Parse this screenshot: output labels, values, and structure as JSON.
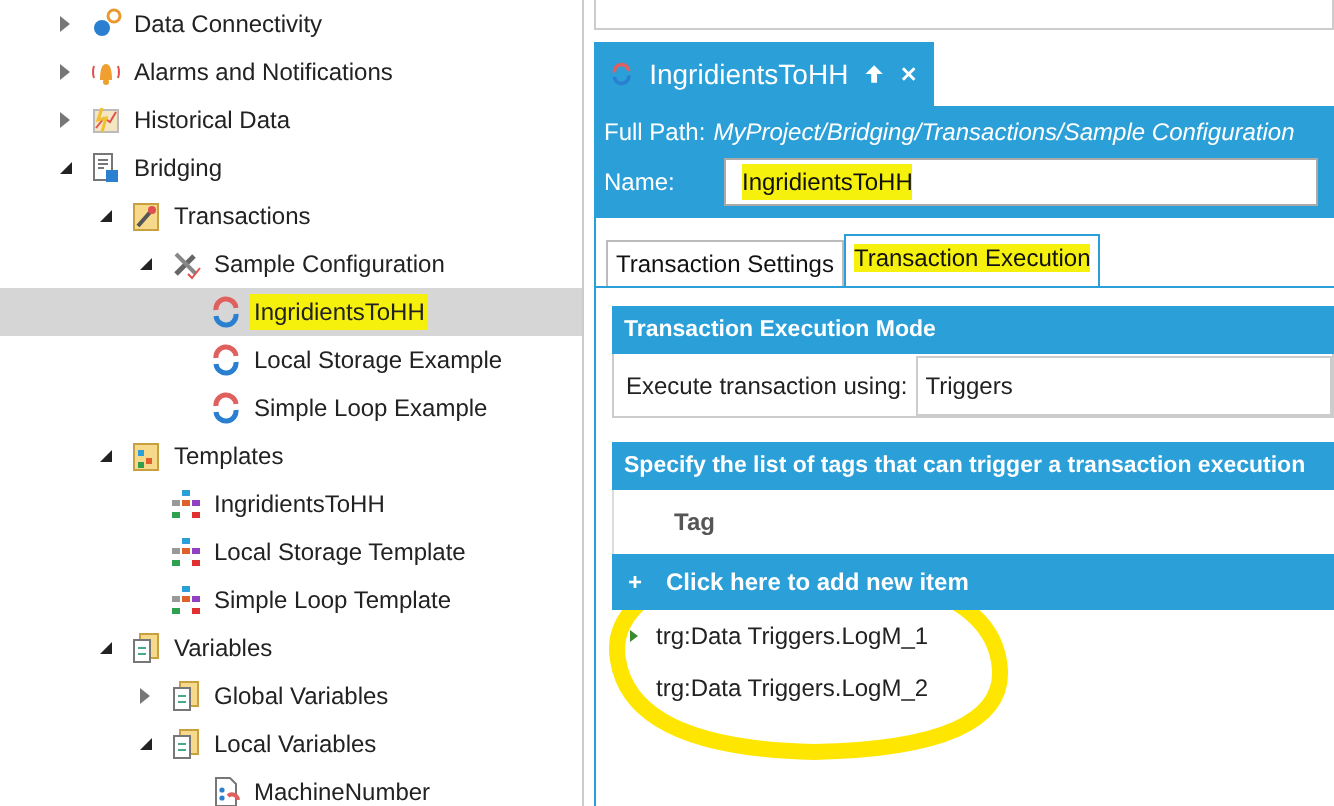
{
  "tree": [
    {
      "label": "Data Connectivity",
      "kind": "gears",
      "expanded": false,
      "selected": false,
      "highlighted": false
    },
    {
      "label": "Alarms and Notifications",
      "kind": "bell",
      "expanded": false,
      "selected": false,
      "highlighted": false
    },
    {
      "label": "Historical Data",
      "kind": "chart",
      "expanded": false,
      "selected": false,
      "highlighted": false
    },
    {
      "label": "Bridging",
      "kind": "document",
      "expanded": true,
      "selected": false,
      "highlighted": false,
      "children": [
        {
          "label": "Transactions",
          "kind": "tools",
          "expanded": true,
          "selected": false,
          "highlighted": false,
          "children": [
            {
              "label": "Sample Configuration",
              "kind": "wrench",
              "expanded": true,
              "selected": false,
              "highlighted": false,
              "children": [
                {
                  "label": "IngridientsToHH",
                  "kind": "cycle",
                  "selected": true,
                  "highlighted": true
                },
                {
                  "label": "Local Storage Example",
                  "kind": "cycle",
                  "selected": false,
                  "highlighted": false
                },
                {
                  "label": "Simple Loop Example",
                  "kind": "cycle",
                  "selected": false,
                  "highlighted": false
                }
              ]
            }
          ]
        },
        {
          "label": "Templates",
          "kind": "folder",
          "expanded": true,
          "selected": false,
          "highlighted": false,
          "children": [
            {
              "label": "IngridientsToHH",
              "kind": "template",
              "selected": false,
              "highlighted": false
            },
            {
              "label": "Local Storage Template",
              "kind": "template",
              "selected": false,
              "highlighted": false
            },
            {
              "label": "Simple Loop Template",
              "kind": "template",
              "selected": false,
              "highlighted": false
            }
          ]
        },
        {
          "label": "Variables",
          "kind": "variables",
          "expanded": true,
          "selected": false,
          "highlighted": false,
          "children": [
            {
              "label": "Global Variables",
              "kind": "variables",
              "expanded": false,
              "selected": false,
              "highlighted": false
            },
            {
              "label": "Local Variables",
              "kind": "variables",
              "expanded": true,
              "selected": false,
              "highlighted": false,
              "children": [
                {
                  "label": "MachineNumber",
                  "kind": "variable",
                  "selected": false,
                  "highlighted": false
                }
              ]
            }
          ]
        }
      ]
    }
  ],
  "document_tab": {
    "title": "IngridientsToHH"
  },
  "header": {
    "path_label": "Full Path:",
    "path": "MyProject/Bridging/Transactions/Sample Configuration",
    "name_label": "Name:",
    "name_value": "IngridientsToHH",
    "name_highlighted": true
  },
  "tabs": [
    {
      "label": "Transaction Settings",
      "selected": false,
      "highlighted": false
    },
    {
      "label": "Transaction Execution",
      "selected": true,
      "highlighted": true
    }
  ],
  "execution_mode": {
    "title": "Execute transaction using:",
    "heading": "Transaction Execution Mode",
    "value": "Triggers"
  },
  "triggers": {
    "heading": "Specify the list of tags that can trigger a transaction execution",
    "column": "Tag",
    "add_icon": "+",
    "add_label": "Click here to add new item",
    "rows": [
      {
        "tag": "trg:Data Triggers.LogM_1",
        "current": true
      },
      {
        "tag": "trg:Data Triggers.LogM_2",
        "current": false
      }
    ]
  },
  "annotation": {
    "kind": "ellipse"
  }
}
